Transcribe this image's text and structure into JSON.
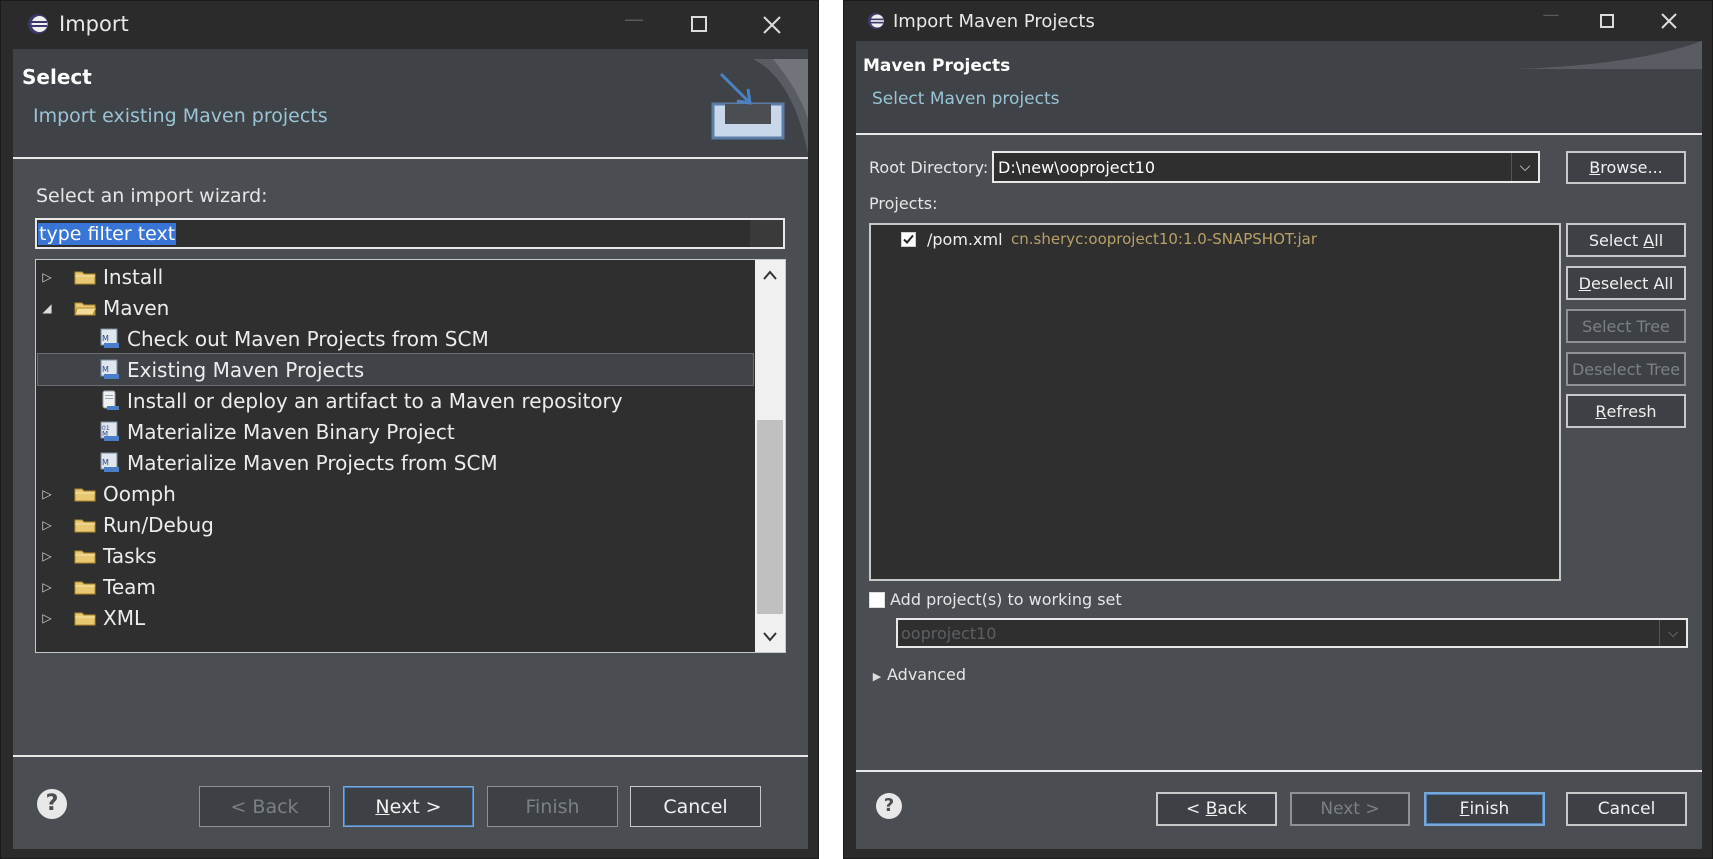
{
  "left_dialog": {
    "title": "Import",
    "header": {
      "title": "Select",
      "description": "Import existing Maven projects"
    },
    "wizard_label": "Select an import wizard:",
    "filter": {
      "value": "type filter text"
    },
    "tree": [
      {
        "label": "Install",
        "type": "folder",
        "expanded": false
      },
      {
        "label": "Maven",
        "type": "folder",
        "expanded": true
      },
      {
        "label": "Check out Maven Projects from SCM",
        "type": "maven"
      },
      {
        "label": "Existing Maven Projects",
        "type": "maven",
        "selected": true
      },
      {
        "label": "Install or deploy an artifact to a Maven repository",
        "type": "jar"
      },
      {
        "label": "Materialize Maven Binary Project",
        "type": "maven"
      },
      {
        "label": "Materialize Maven Projects from SCM",
        "type": "maven"
      },
      {
        "label": "Oomph",
        "type": "folder",
        "expanded": false
      },
      {
        "label": "Run/Debug",
        "type": "folder",
        "expanded": false
      },
      {
        "label": "Tasks",
        "type": "folder",
        "expanded": false
      },
      {
        "label": "Team",
        "type": "folder",
        "expanded": false
      },
      {
        "label": "XML",
        "type": "folder",
        "expanded": false
      }
    ],
    "buttons": {
      "back": "< Back",
      "next_prefix": "N",
      "next_rest": "ext >",
      "finish": "Finish",
      "cancel": "Cancel"
    }
  },
  "right_dialog": {
    "title": "Import Maven Projects",
    "header": {
      "title": "Maven Projects",
      "description": "Select Maven projects"
    },
    "root_directory_label": "Root Directory:",
    "root_directory_value": "D:\\new\\ooproject10",
    "browse_prefix": "B",
    "browse_rest": "rowse...",
    "projects_label": "Projects:",
    "project": {
      "path": "/pom.xml",
      "artifact": "cn.sheryc:ooproject10:1.0-SNAPSHOT:jar",
      "checked": true
    },
    "side_buttons": {
      "select_all_a": "Select ",
      "select_all_b": "A",
      "select_all_c": "ll",
      "deselect_all_a": "D",
      "deselect_all_b": "eselect All",
      "select_tree": "Select Tree",
      "deselect_tree": "Deselect Tree",
      "refresh_a": "R",
      "refresh_b": "efresh"
    },
    "working_set_label": "Add project(s) to working set",
    "working_set_value": "ooproject10",
    "advanced_label": "Advanced",
    "buttons": {
      "back_a": "< ",
      "back_b": "B",
      "back_c": "ack",
      "next": "Next >",
      "finish_a": "F",
      "finish_b": "inish",
      "cancel": "Cancel"
    }
  },
  "colors": {
    "header_desc": "#9ac4d6",
    "artifact_text": "#b8a068",
    "default_button_border": "#78a6d8"
  }
}
